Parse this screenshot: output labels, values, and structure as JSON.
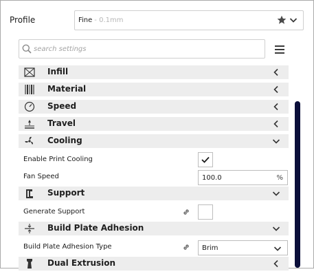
{
  "profile": {
    "label": "Profile",
    "name": "Fine",
    "sub": " - 0.1mm"
  },
  "search": {
    "placeholder": "search settings"
  },
  "categories": {
    "infill": "Infill",
    "material": "Material",
    "speed": "Speed",
    "travel": "Travel",
    "cooling": "Cooling",
    "support": "Support",
    "adhesion": "Build Plate Adhesion",
    "dual": "Dual Extrusion"
  },
  "settings": {
    "enable_cooling": {
      "label": "Enable Print Cooling",
      "checked": true
    },
    "fan_speed": {
      "label": "Fan Speed",
      "value": "100.0",
      "unit": "%"
    },
    "generate_support": {
      "label": "Generate Support",
      "checked": false
    },
    "adhesion_type": {
      "label": "Build Plate Adhesion Type",
      "value": "Brim"
    }
  },
  "colors": {
    "category_bg": "#ededed",
    "scrollbar": "#0b0f3a",
    "border": "#bdbdbd"
  }
}
